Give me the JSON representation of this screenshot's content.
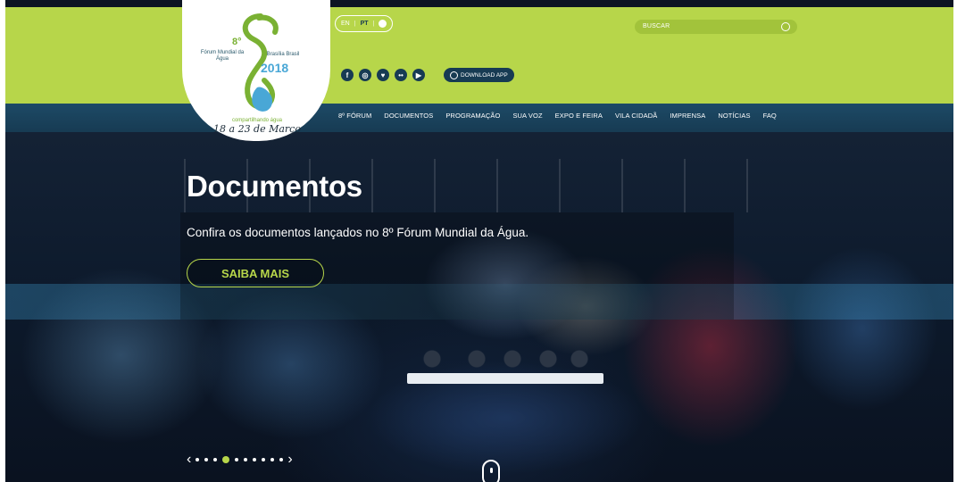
{
  "logo": {
    "edition": "8°",
    "name": "Fórum Mundial da Água",
    "city": "Brasília Brasil",
    "year": "2018",
    "tagline": "compartilhando água",
    "dates": "18 a 23 de Março"
  },
  "lang": {
    "en": "EN",
    "pt": "PT",
    "sep": "|"
  },
  "search": {
    "placeholder": "BUSCAR"
  },
  "social": [
    "f",
    "◎",
    "♥",
    "••",
    "▶"
  ],
  "download": {
    "label": "DOWNLOAD APP"
  },
  "nav": [
    "8º FÓRUM",
    "DOCUMENTOS",
    "PROGRAMAÇÃO",
    "SUA VOZ",
    "EXPO E FEIRA",
    "VILA CIDADÃ",
    "IMPRENSA",
    "NOTÍCIAS",
    "FAQ"
  ],
  "hero": {
    "title": "Documentos",
    "subtitle": "Confira os documentos lançados no 8º Fórum Mundial da Água.",
    "cta": "SAIBA MAIS"
  },
  "carousel": {
    "prev": "‹",
    "next": "›",
    "count": 10,
    "active": 3
  },
  "colors": {
    "brand_green": "#b7d64a",
    "nav_blue": "#173b53"
  },
  "icons": [
    "facebook-icon",
    "instagram-icon",
    "twitter-icon",
    "flickr-icon",
    "youtube-icon",
    "globe-icon",
    "search-icon",
    "app-icon",
    "scroll-down-icon"
  ]
}
